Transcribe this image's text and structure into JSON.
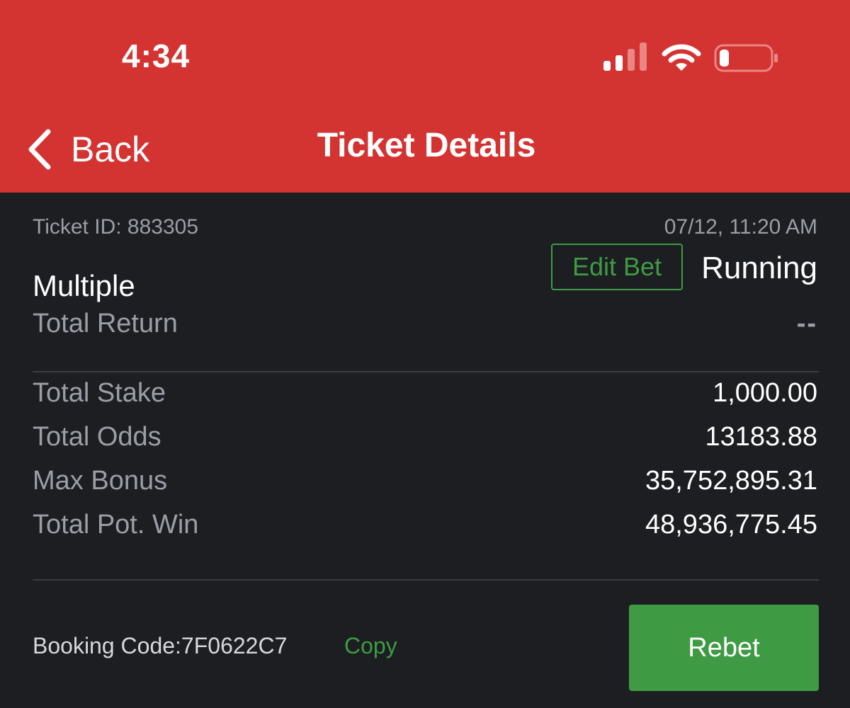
{
  "status_bar": {
    "time": "4:34"
  },
  "nav": {
    "back_label": "Back",
    "title": "Ticket Details"
  },
  "ticket": {
    "id_label": "Ticket ID: 883305",
    "datetime": "07/12, 11:20 AM",
    "bet_type": "Multiple",
    "edit_bet_label": "Edit Bet",
    "status": "Running",
    "total_return_label": "Total Return",
    "total_return_value": "--"
  },
  "summary": {
    "rows": [
      {
        "label": "Total Stake",
        "value": "1,000.00"
      },
      {
        "label": "Total Odds",
        "value": "13183.88"
      },
      {
        "label": "Max Bonus",
        "value": "35,752,895.31"
      },
      {
        "label": "Total Pot. Win",
        "value": "48,936,775.45"
      }
    ]
  },
  "footer": {
    "booking_code": "Booking Code:7F0622C7",
    "copy_label": "Copy",
    "rebet_label": "Rebet"
  },
  "colors": {
    "header_red": "#d33331",
    "background": "#1c1e22",
    "accent_green": "#3f9b43",
    "muted_text": "#9a9ea6"
  },
  "icons": [
    "cellular-signal-icon",
    "wifi-icon",
    "battery-low-icon",
    "chevron-left-icon"
  ]
}
